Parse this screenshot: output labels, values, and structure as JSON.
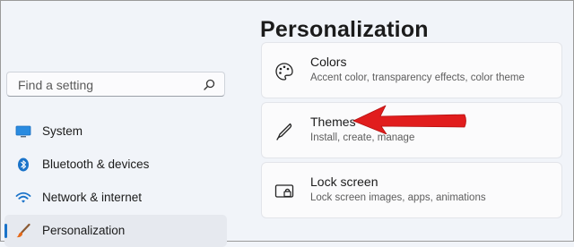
{
  "page": {
    "title": "Personalization"
  },
  "search": {
    "placeholder": "Find a setting"
  },
  "sidebar": {
    "items": [
      {
        "label": "System",
        "icon": "monitor-icon",
        "selected": false
      },
      {
        "label": "Bluetooth & devices",
        "icon": "bluetooth-icon",
        "selected": false
      },
      {
        "label": "Network & internet",
        "icon": "wifi-icon",
        "selected": false
      },
      {
        "label": "Personalization",
        "icon": "brush-icon",
        "selected": true
      }
    ]
  },
  "cards": [
    {
      "title": "Colors",
      "subtitle": "Accent color, transparency effects, color theme",
      "icon": "palette-icon"
    },
    {
      "title": "Themes",
      "subtitle": "Install, create, manage",
      "icon": "pen-icon"
    },
    {
      "title": "Lock screen",
      "subtitle": "Lock screen images, apps, animations",
      "icon": "lock-screen-icon"
    }
  ],
  "annotation": {
    "arrow_color": "#e11d1d",
    "points_to": "Themes"
  },
  "colors": {
    "accent": "#1a73c9",
    "background": "#f1f4f9",
    "card": "#fbfbfc"
  }
}
